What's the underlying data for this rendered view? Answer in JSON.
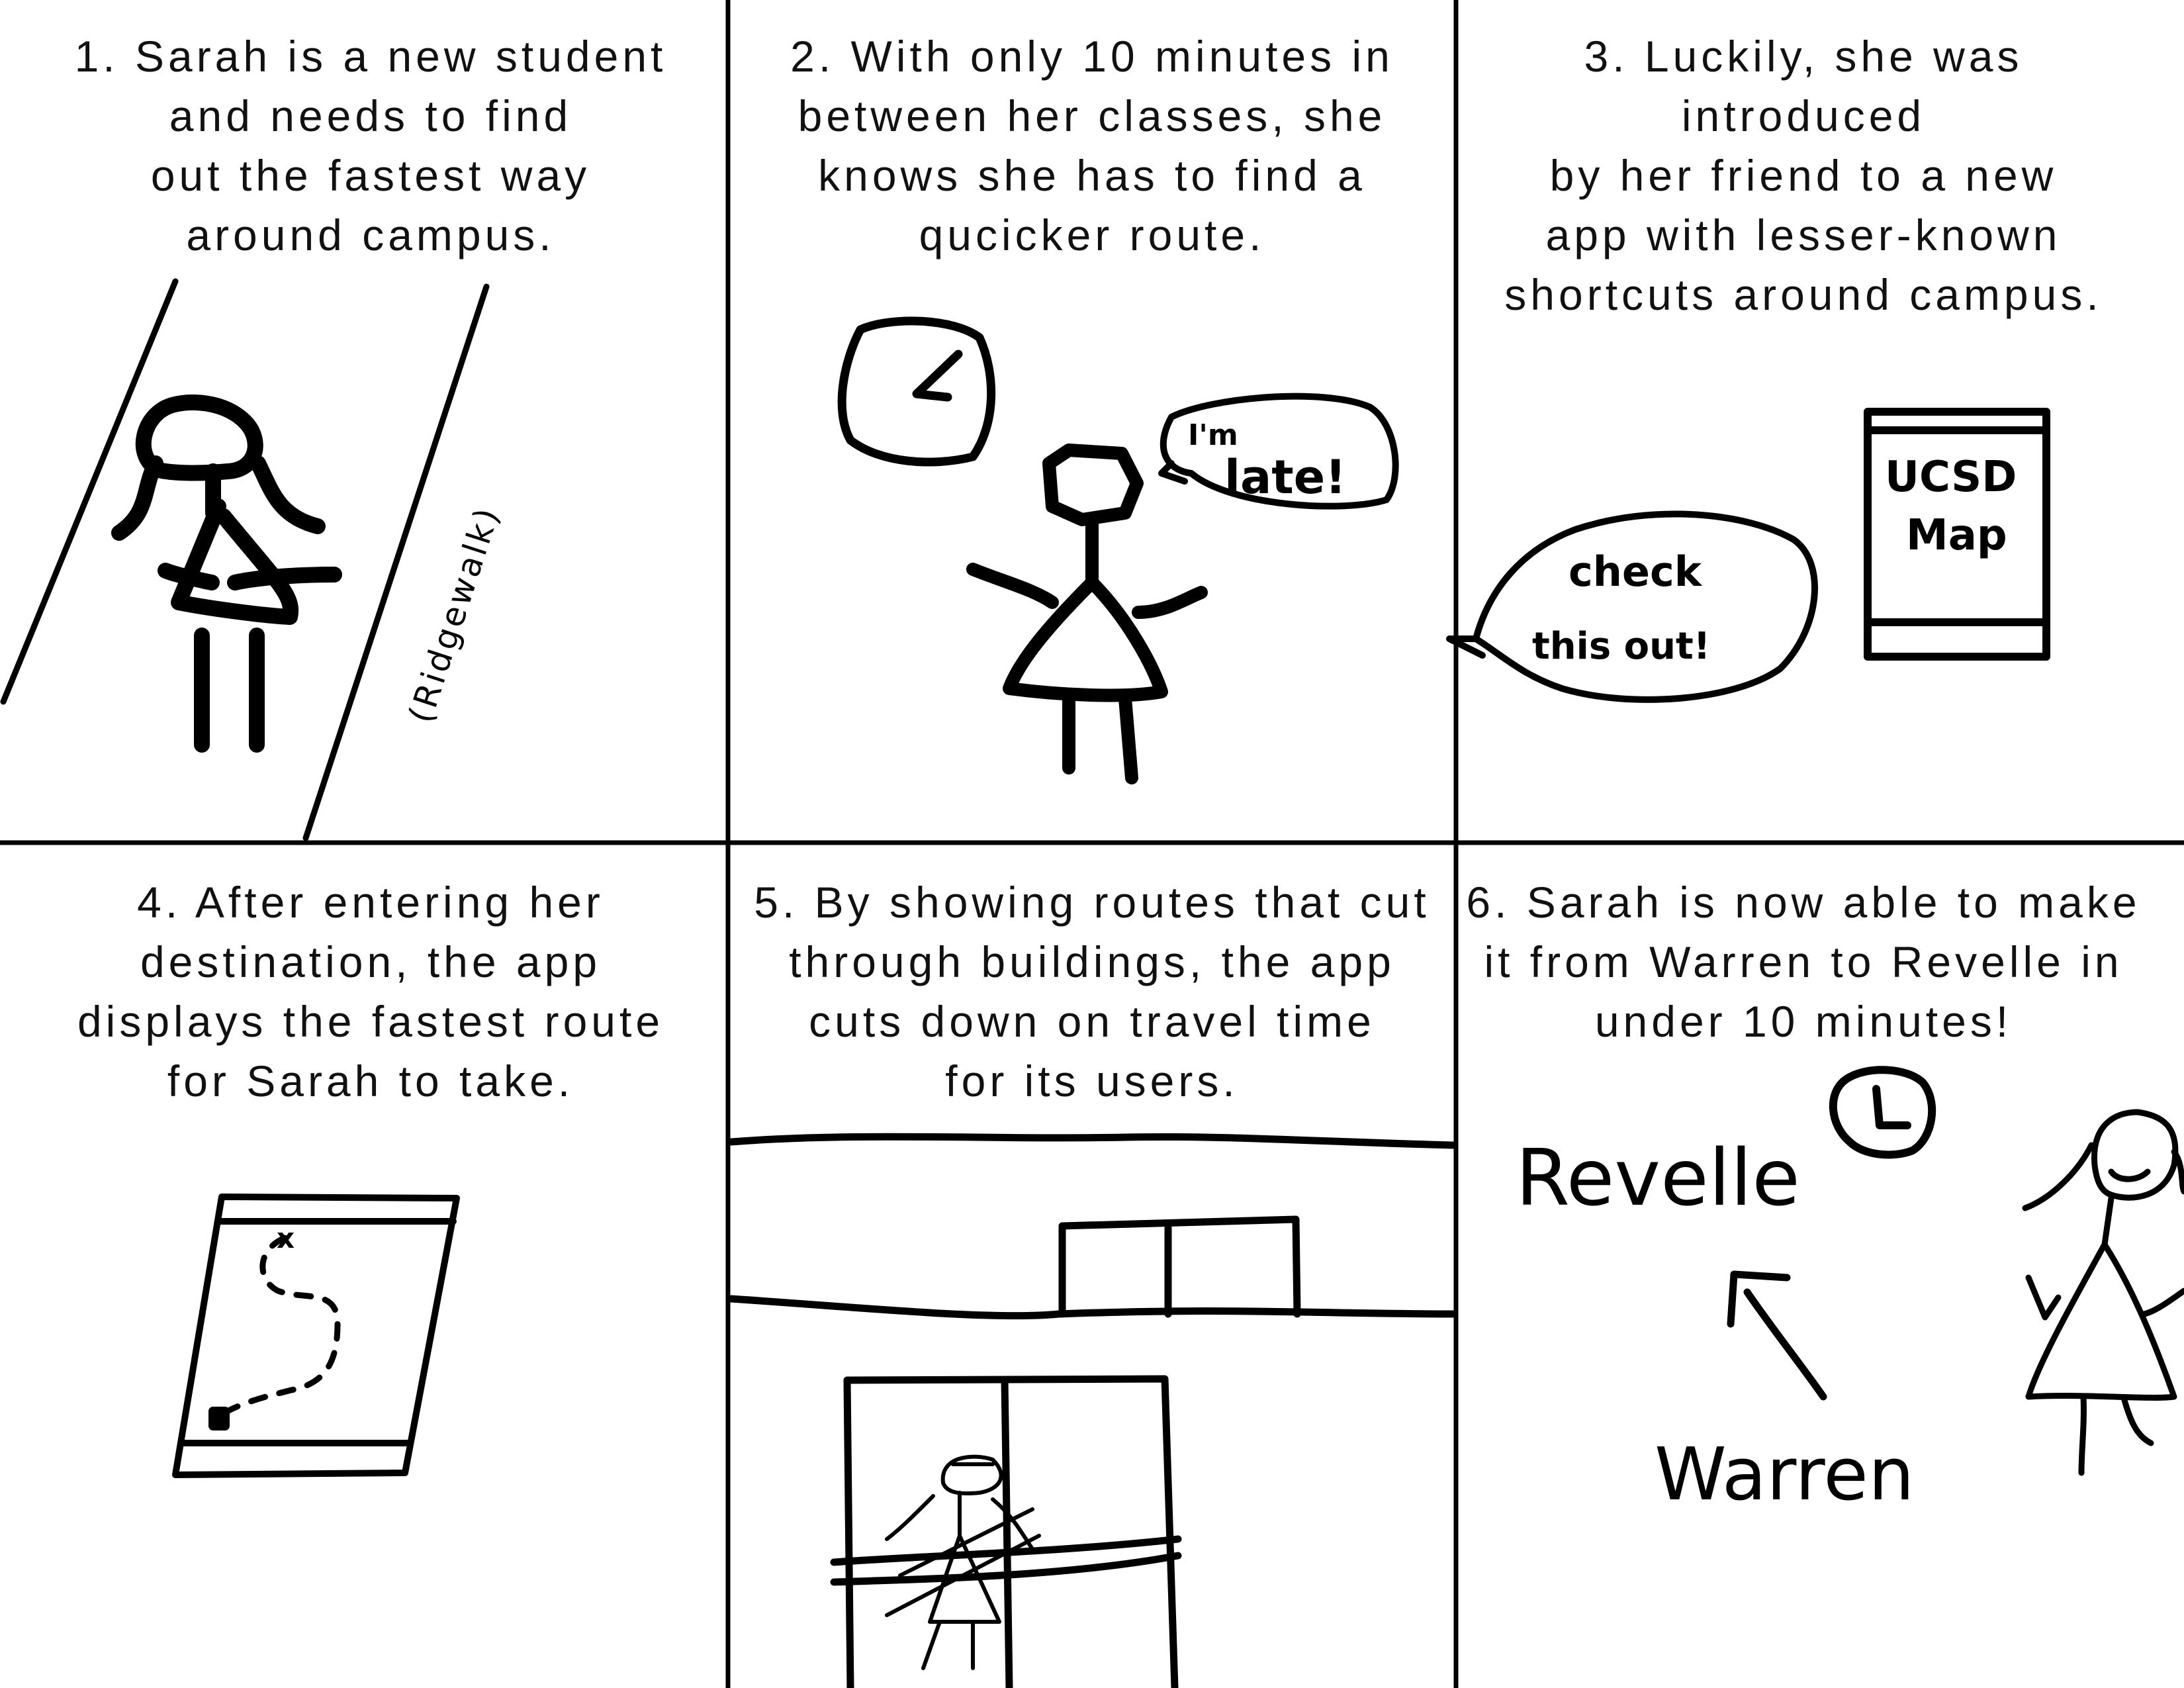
{
  "panels": [
    {
      "caption": "1. Sarah is a new student\nand needs to find\nout the fastest way\naround campus.",
      "labels": {
        "path": "(Ridgewalk)"
      }
    },
    {
      "caption": "2. With only 10 minutes in\nbetween her classes, she\nknows she has to find a\nqucicker route.",
      "labels": {
        "speech_line1": "I'm",
        "speech_line2": "late!"
      }
    },
    {
      "caption": "3. Luckily, she was introduced\nby her friend to a new\napp with lesser-known\nshortcuts around campus.",
      "labels": {
        "speech_line1": "check",
        "speech_line2": "this out!",
        "app_line1": "UCSD",
        "app_line2": "Map"
      }
    },
    {
      "caption": "4. After entering her\ndestination, the app\ndisplays the fastest route\nfor Sarah to take.",
      "labels": {
        "marker": "x"
      }
    },
    {
      "caption": "5. By showing routes that cut\nthrough buildings, the app\ncuts down on travel time\nfor its users.",
      "labels": {}
    },
    {
      "caption": "6. Sarah is now able to make\nit from Warren to Revelle in\nunder 10 minutes!",
      "labels": {
        "destination": "Revelle",
        "origin": "Warren"
      }
    }
  ],
  "colors": {
    "ink": "#000000",
    "paper": "#ffffff"
  }
}
